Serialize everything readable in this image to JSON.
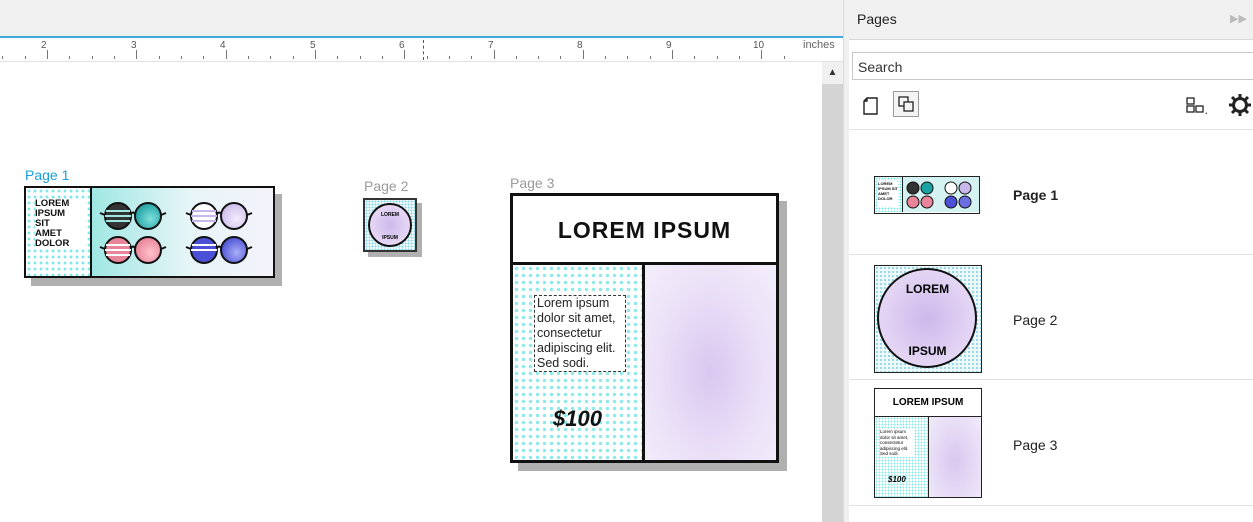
{
  "ruler": {
    "numbers": [
      "2",
      "3",
      "4",
      "5",
      "6",
      "7",
      "8",
      "9",
      "10"
    ],
    "unit": "inches"
  },
  "canvas": {
    "page1": {
      "label": "Page 1",
      "text": [
        "LOREM",
        "IPSUM",
        "SIT",
        "AMET",
        "DOLOR"
      ]
    },
    "page2": {
      "label": "Page 2",
      "top_text": "LOREM",
      "bottom_text": "IPSUM"
    },
    "page3": {
      "label": "Page 3",
      "header": "LOREM IPSUM",
      "body": "Lorem ipsum dolor sit amet, consectetur adipiscing elit. Sed sodi.",
      "price": "$100"
    }
  },
  "panel": {
    "title": "Pages",
    "search_placeholder": "Search",
    "pages": [
      {
        "label": "Page 1",
        "selected": true
      },
      {
        "label": "Page 2",
        "selected": false
      },
      {
        "label": "Page 3",
        "selected": false
      }
    ]
  },
  "colors": {
    "accent": "#1a9fde",
    "teal": "#1aa3a3",
    "pink": "#e8859a",
    "lavender": "#c9b7ea",
    "blue": "#4b51d6"
  }
}
